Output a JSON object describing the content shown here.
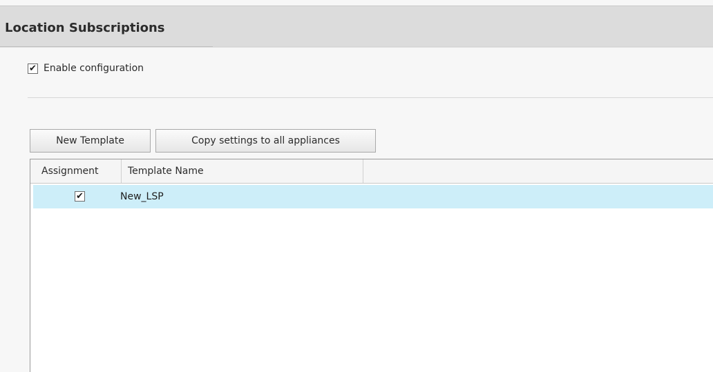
{
  "header": {
    "title": "Location Subscriptions"
  },
  "config": {
    "enable_label": "Enable configuration",
    "enable_checked": true
  },
  "toolbar": {
    "new_template_label": "New Template",
    "copy_settings_label": "Copy settings to all appliances"
  },
  "grid": {
    "columns": [
      "Assignment",
      "Template Name",
      ""
    ],
    "rows": [
      {
        "assigned": true,
        "template_name": "New_LSP",
        "selected": true
      }
    ]
  },
  "icons": {
    "checkmark": "check-icon"
  },
  "colors": {
    "header_bg": "#dcdcdc",
    "selected_row": "#cdeef9"
  }
}
